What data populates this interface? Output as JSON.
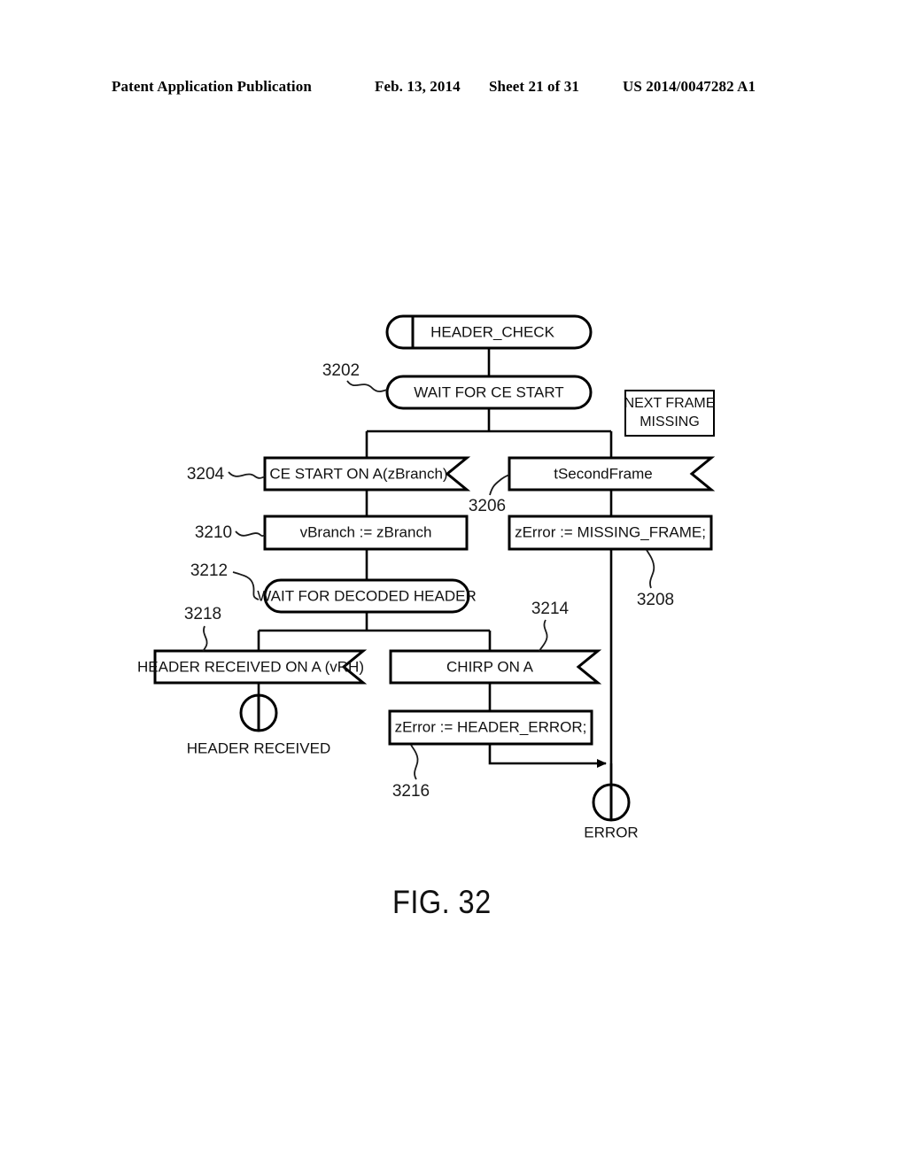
{
  "header": {
    "title": "Patent Application Publication",
    "date": "Feb. 13, 2014",
    "sheet": "Sheet 21 of 31",
    "publication_number": "US 2014/0047282 A1"
  },
  "figure": {
    "caption": "FIG. 32",
    "nodes": {
      "header_check": "HEADER_CHECK",
      "wait_ce_start": "WAIT FOR CE START",
      "ce_start_on_a": "CE START ON A(zBranch)",
      "t_second_frame": "tSecondFrame",
      "v_branch_assign": "vBranch := zBranch",
      "z_error_missing": "zError := MISSING_FRAME;",
      "wait_decoded_header": "WAIT FOR DECODED HEADER",
      "header_received_on_a": "HEADER RECEIVED ON A (vRH)",
      "chirp_on_a": "CHIRP ON A",
      "z_error_header": "zError := HEADER_ERROR;"
    },
    "note": {
      "next_frame_missing_line1": "NEXT FRAME",
      "next_frame_missing_line2": "MISSING"
    },
    "terminators": {
      "header_received": "HEADER RECEIVED",
      "error": "ERROR"
    },
    "reference_numerals": {
      "n3202": "3202",
      "n3204": "3204",
      "n3206": "3206",
      "n3208": "3208",
      "n3210": "3210",
      "n3212": "3212",
      "n3214": "3214",
      "n3216": "3216",
      "n3218": "3218"
    }
  }
}
